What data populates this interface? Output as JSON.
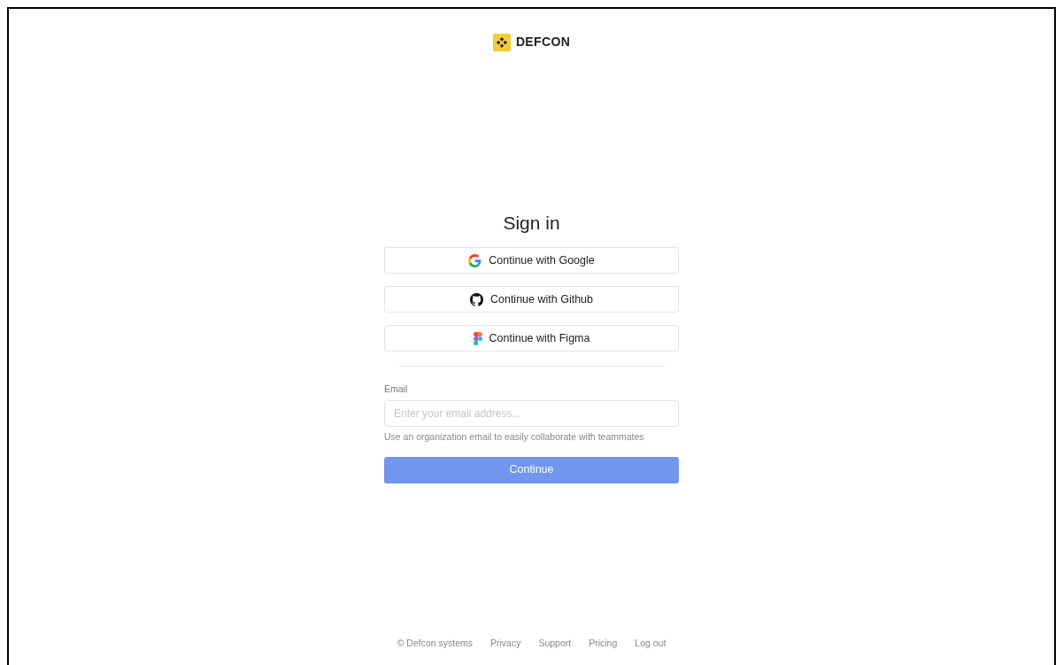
{
  "brand": {
    "name": "DEFCON"
  },
  "title": "Sign in",
  "providers": [
    {
      "kind": "google",
      "label": "Continue with Google"
    },
    {
      "kind": "github",
      "label": "Continue with Github"
    },
    {
      "kind": "figma",
      "label": "Continue with Figma"
    }
  ],
  "email": {
    "label": "Email",
    "placeholder": "Enter your email address...",
    "hint": "Use an organization email to easily collaborate with teammates"
  },
  "submit": {
    "label": "Continue",
    "disabled": true
  },
  "footer": {
    "copyright": "© Defcon systems",
    "links": [
      "Privacy",
      "Support",
      "Pricing",
      "Log out"
    ]
  }
}
